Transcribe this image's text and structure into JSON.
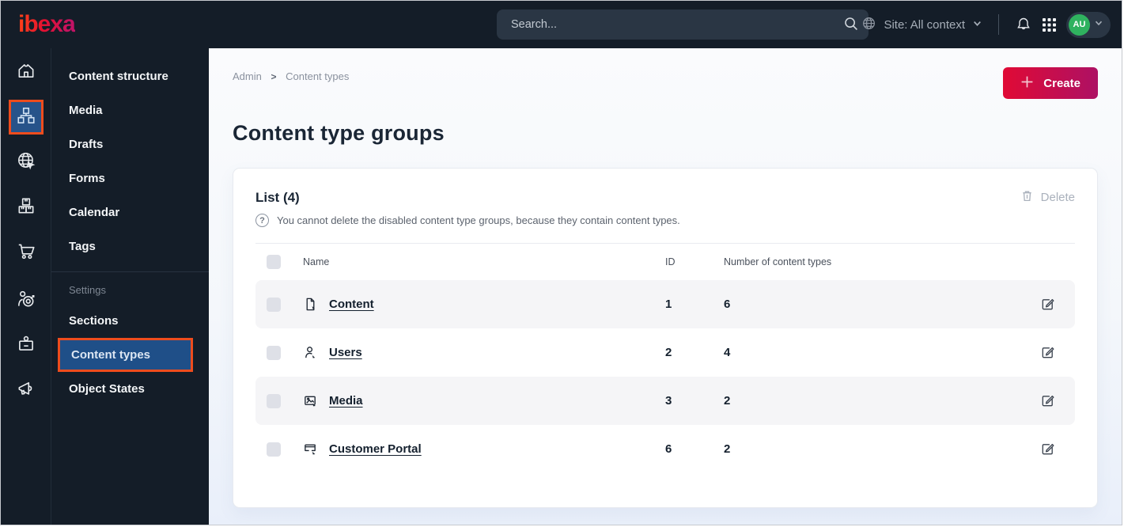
{
  "topbar": {
    "logo_text": "ibexa",
    "search_placeholder": "Search...",
    "site_label": "Site: All context",
    "avatar_initials": "AU"
  },
  "sidebar": {
    "icons": [
      {
        "name": "home-icon",
        "active": false
      },
      {
        "name": "content-structure-icon",
        "active": true
      },
      {
        "name": "site-globe-icon",
        "active": false
      },
      {
        "name": "packages-icon",
        "active": false
      },
      {
        "name": "cart-icon",
        "active": false
      },
      {
        "name": "audience-target-icon",
        "active": false
      },
      {
        "name": "badge-icon",
        "active": false
      },
      {
        "name": "megaphone-icon",
        "active": false
      }
    ]
  },
  "menu": {
    "items": [
      "Content structure",
      "Media",
      "Drafts",
      "Forms",
      "Calendar",
      "Tags"
    ],
    "settings_label": "Settings",
    "settings_items": [
      "Sections",
      "Content types",
      "Object States"
    ],
    "selected_item": "Content types"
  },
  "main": {
    "breadcrumb": {
      "items": [
        "Admin",
        "Content types"
      ],
      "separator": ">"
    },
    "create_label": "Create",
    "page_title": "Content type groups",
    "list": {
      "title": "List (4)",
      "hint_symbol": "?",
      "hint": "You cannot delete the disabled content type groups, because they contain content types.",
      "delete_label": "Delete",
      "columns": {
        "name": "Name",
        "id": "ID",
        "count": "Number of content types"
      },
      "rows": [
        {
          "icon": "content-file-icon",
          "name": "Content",
          "id": "1",
          "count": "6"
        },
        {
          "icon": "users-person-icon",
          "name": "Users",
          "id": "2",
          "count": "4"
        },
        {
          "icon": "media-image-icon",
          "name": "Media",
          "id": "3",
          "count": "2"
        },
        {
          "icon": "customer-portal-icon",
          "name": "Customer Portal",
          "id": "6",
          "count": "2"
        }
      ]
    }
  },
  "colors": {
    "topbar_bg": "#141d28",
    "highlight_orange": "#ee4c1d",
    "selected_blue": "#1f4f88",
    "create_gradient_start": "#e00a35",
    "create_gradient_end": "#ad1164",
    "avatar_green": "#2fb25f",
    "row_alt_bg": "#f5f5f7"
  }
}
